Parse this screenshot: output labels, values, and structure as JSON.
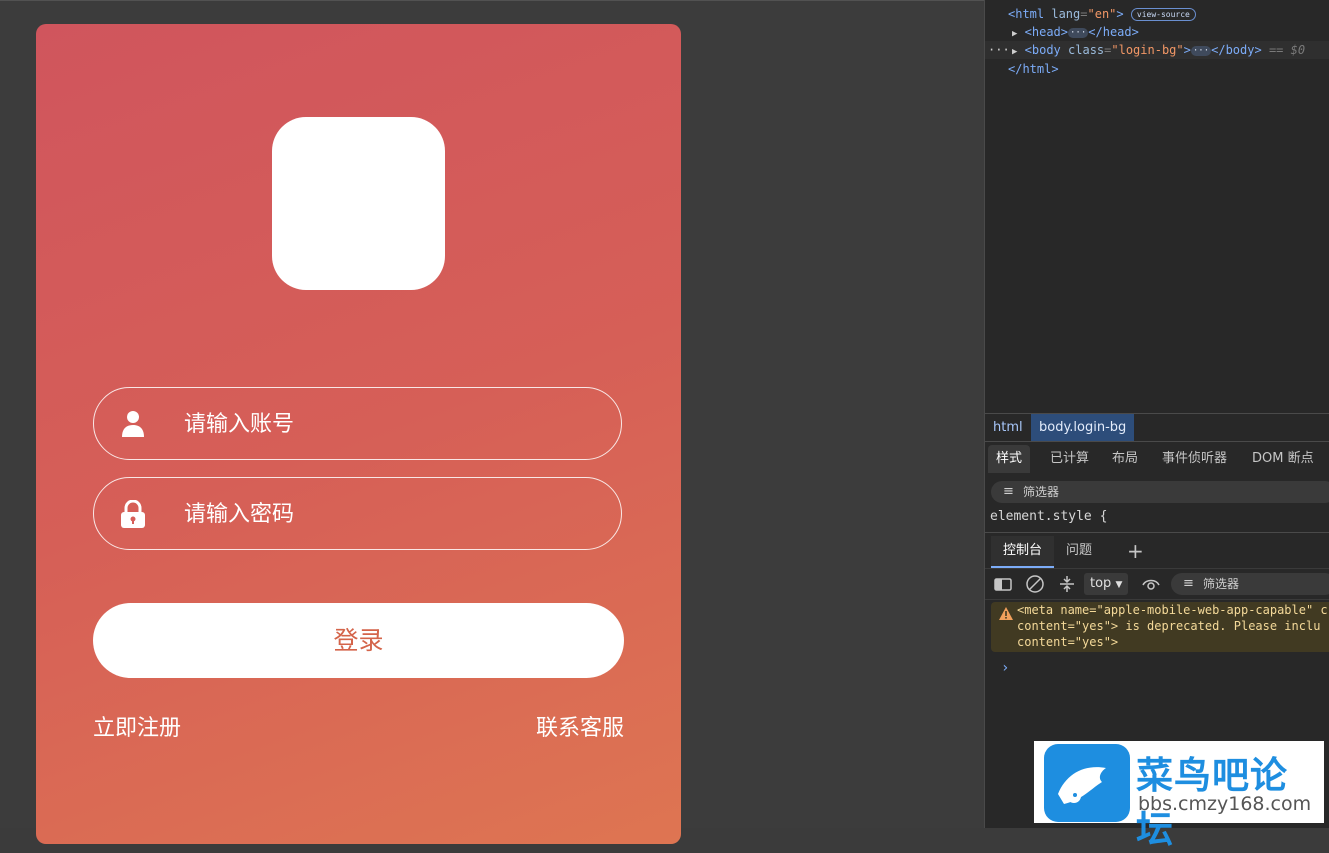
{
  "login": {
    "username_placeholder": "请输入账号",
    "password_placeholder": "请输入密码",
    "login_label": "登录",
    "register_label": "立即注册",
    "support_label": "联系客服"
  },
  "devtools": {
    "dom": {
      "html_open": "<html",
      "html_attr": "lang",
      "html_val": "\"en\"",
      "view_source": "view-source",
      "head": "<head>",
      "head_close": "</head>",
      "body_open": "<body",
      "body_attr": "class",
      "body_val": "\"login-bg\"",
      "body_close": "</body>",
      "selected_marker": "== $0",
      "html_close": "</html>"
    },
    "breadcrumbs": [
      "html",
      "body.login-bg"
    ],
    "style_tabs": [
      "样式",
      "已计算",
      "布局",
      "事件侦听器",
      "DOM 断点"
    ],
    "filter_label": "筛选器",
    "element_style": "element.style {",
    "console_tabs": [
      "控制台",
      "问题"
    ],
    "context": "top",
    "console_filter": "筛选器",
    "warning_lines": [
      "<meta name=\"apple-mobile-web-app-capable\" c",
      "content=\"yes\"> is deprecated. Please inclu",
      "content=\"yes\">"
    ],
    "prompt": "›"
  },
  "watermark": {
    "title": "菜鸟吧论坛",
    "url": "bbs.cmzy168.com"
  },
  "colors": {
    "gradient_start": "#d0555d",
    "gradient_end": "#de7552",
    "login_text": "#d4644a",
    "devtools_bg": "#282828",
    "watermark_blue": "#1e8ee0"
  },
  "icons": [
    "user-icon",
    "lock-icon",
    "warning-icon",
    "dock-icon",
    "clear-icon",
    "filter-icon",
    "eye-icon",
    "add-tab-icon",
    "caret-down-icon",
    "bird-logo-icon"
  ]
}
